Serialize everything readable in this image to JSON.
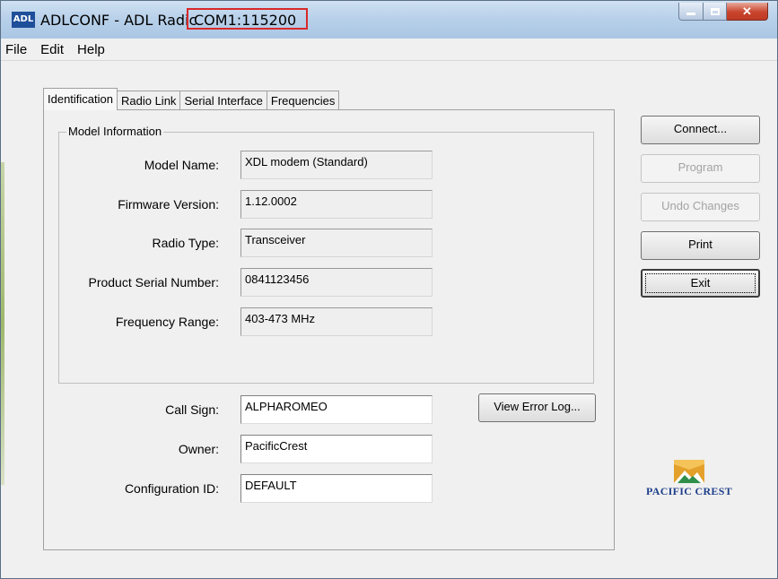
{
  "window": {
    "icon_text": "ADL",
    "title": "ADLCONF - ADL Radic",
    "title_port": "COM1:115200"
  },
  "menu": [
    "File",
    "Edit",
    "Help"
  ],
  "tabs": [
    "Identification",
    "Radio Link",
    "Serial Interface",
    "Frequencies"
  ],
  "model_info": {
    "legend": "Model Information",
    "fields": [
      {
        "label": "Model Name:",
        "value": "XDL modem (Standard)"
      },
      {
        "label": "Firmware Version:",
        "value": "1.12.0002"
      },
      {
        "label": "Radio Type:",
        "value": "Transceiver"
      },
      {
        "label": "Product Serial Number:",
        "value": "0841123456"
      },
      {
        "label": "Frequency Range:",
        "value": "403-473 MHz"
      }
    ]
  },
  "settings": {
    "fields": [
      {
        "label": "Call Sign:",
        "value": "ALPHAROMEO"
      },
      {
        "label": "Owner:",
        "value": "PacificCrest"
      },
      {
        "label": "Configuration ID:",
        "value": "DEFAULT"
      }
    ],
    "view_error_log": "View Error Log..."
  },
  "buttons": {
    "connect": "Connect...",
    "program": "Program",
    "undo": "Undo Changes",
    "print": "Print",
    "exit": "Exit"
  },
  "logo": {
    "text": "PACIFIC CREST",
    "colors": {
      "primary": "#1e3f8a",
      "accent": "#e3a12b",
      "green": "#2f8f4a"
    }
  },
  "colors": {
    "highlight_border": "#d82a2a"
  }
}
